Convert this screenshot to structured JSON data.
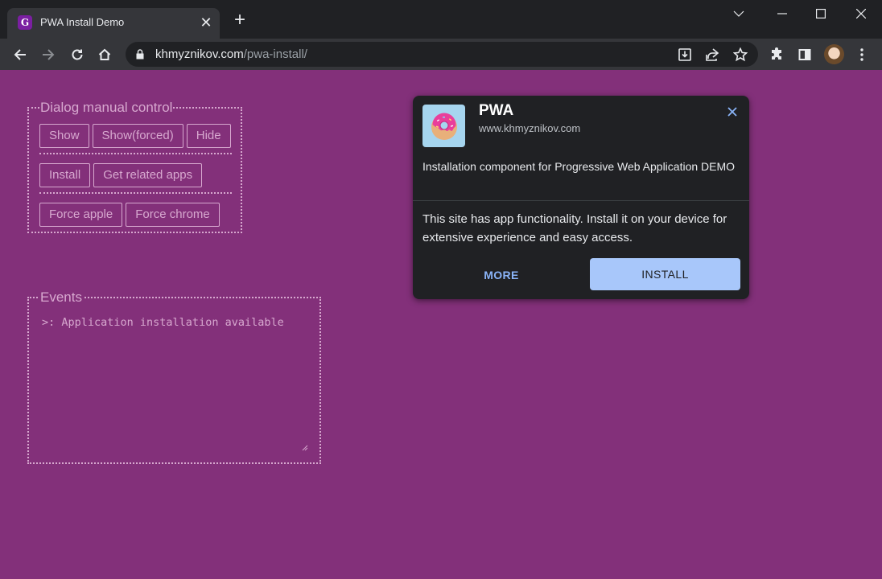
{
  "browser": {
    "tab_title": "PWA Install Demo",
    "tab_close": "✕",
    "new_tab": "+",
    "url_host": "khmyznikov.com",
    "url_path": "/pwa-install/"
  },
  "page": {
    "control_legend": "Dialog manual control",
    "buttons_row1": [
      "Show",
      "Show(forced)",
      "Hide"
    ],
    "buttons_row2": [
      "Install",
      "Get related apps"
    ],
    "buttons_row3": [
      "Force apple",
      "Force chrome"
    ],
    "events_legend": "Events",
    "events_log": ">: Application installation available"
  },
  "dialog": {
    "app_name": "PWA",
    "app_url": "www.khmyznikov.com",
    "description": "Installation component for Progressive Web Application DEMO",
    "message": "This site has app functionality. Install it on your device for extensive experience and easy access.",
    "more_label": "MORE",
    "install_label": "INSTALL"
  },
  "colors": {
    "page_bg": "#83307a",
    "accent_text": "#d7a8cf",
    "dialog_bg": "#202124",
    "install_button": "#a8c7fa",
    "link_blue": "#8ab4f8"
  }
}
